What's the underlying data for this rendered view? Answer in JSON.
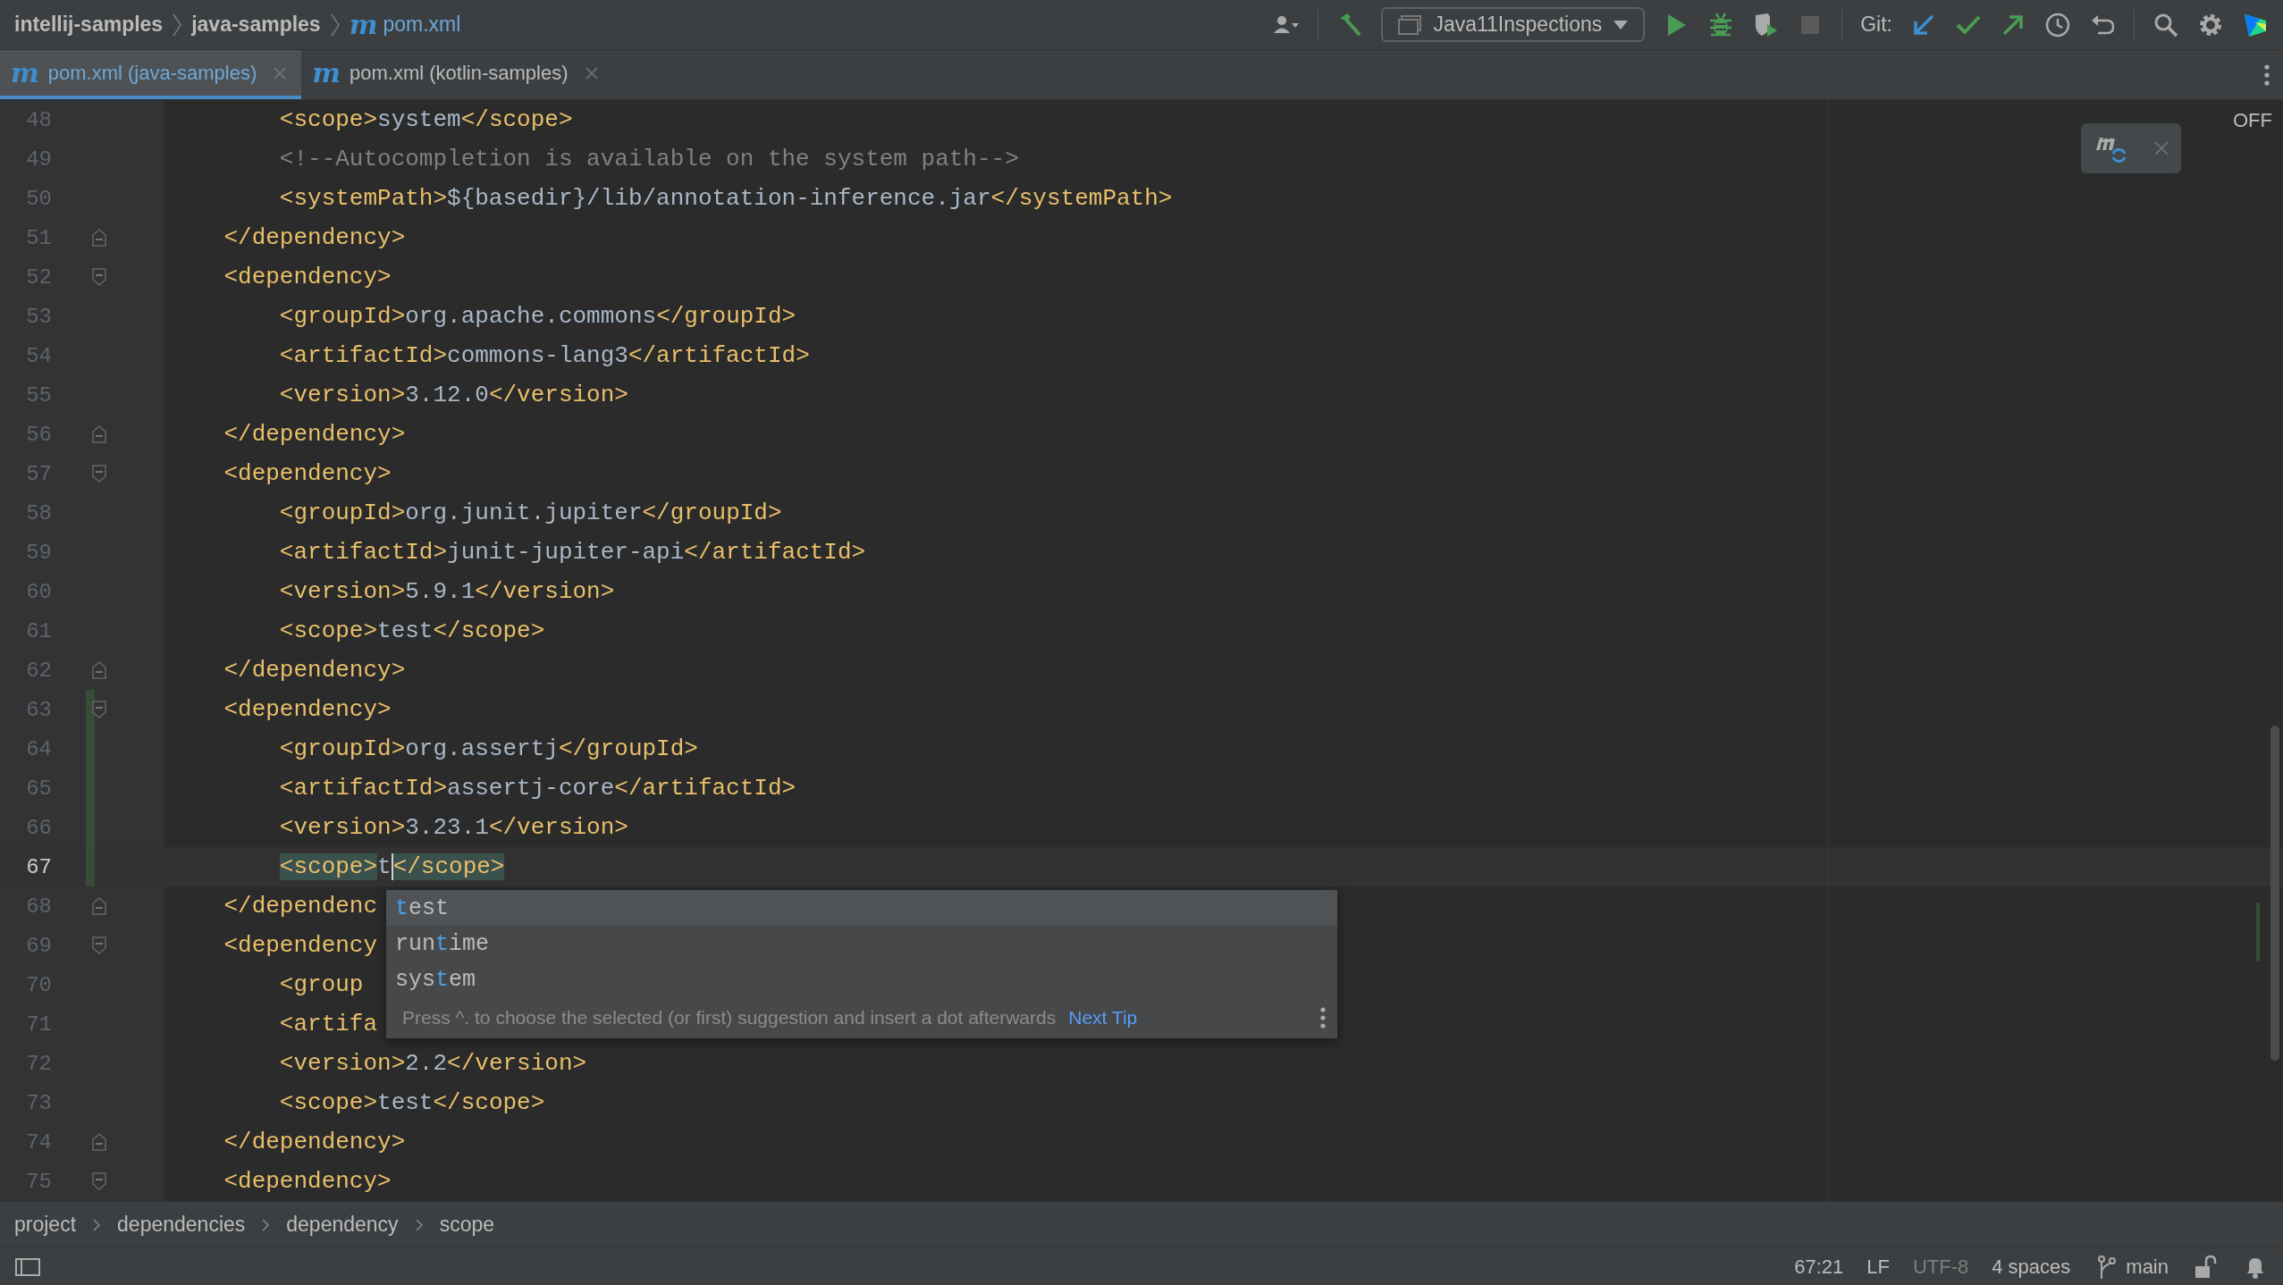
{
  "navbar": {
    "path": [
      {
        "label": "intellij-samples",
        "kind": "folder"
      },
      {
        "label": "java-samples",
        "kind": "folder"
      },
      {
        "label": "pom.xml",
        "kind": "file",
        "glyph": "m"
      }
    ],
    "run_config": "Java11Inspections",
    "git_label": "Git:"
  },
  "tabs": [
    {
      "glyph": "m",
      "label": "pom.xml (java-samples)",
      "selected": true
    },
    {
      "glyph": "m",
      "label": "pom.xml (kotlin-samples)",
      "selected": false
    }
  ],
  "editor": {
    "highlighting": "OFF",
    "lines": [
      {
        "number": "48",
        "kind": "plain",
        "tokens": [
          {
            "kind": "tag",
            "text": "        <scope>"
          },
          {
            "kind": "value",
            "text": "system"
          },
          {
            "kind": "tag",
            "text": "</scope>"
          }
        ]
      },
      {
        "number": "49",
        "kind": "plain",
        "tokens": [
          {
            "kind": "comment",
            "text": "        <!--Autocompletion is available on the system path-->"
          }
        ]
      },
      {
        "number": "50",
        "kind": "plain",
        "tokens": [
          {
            "kind": "tag",
            "text": "        <systemPath>"
          },
          {
            "kind": "value",
            "text": "${basedir}/lib/annotation-inference.jar"
          },
          {
            "kind": "tag",
            "text": "</systemPath>"
          }
        ]
      },
      {
        "number": "51",
        "kind": "fold_end",
        "tokens": [
          {
            "kind": "tag",
            "text": "    </dependency>"
          }
        ]
      },
      {
        "number": "52",
        "kind": "fold_start",
        "tokens": [
          {
            "kind": "tag",
            "text": "    <dependency>"
          }
        ]
      },
      {
        "number": "53",
        "kind": "plain",
        "tokens": [
          {
            "kind": "tag",
            "text": "        <groupId>"
          },
          {
            "kind": "value",
            "text": "org.apache.commons"
          },
          {
            "kind": "tag",
            "text": "</groupId>"
          }
        ]
      },
      {
        "number": "54",
        "kind": "plain",
        "tokens": [
          {
            "kind": "tag",
            "text": "        <artifactId>"
          },
          {
            "kind": "value",
            "text": "commons-lang3"
          },
          {
            "kind": "tag",
            "text": "</artifactId>"
          }
        ]
      },
      {
        "number": "55",
        "kind": "plain",
        "tokens": [
          {
            "kind": "tag",
            "text": "        <version>"
          },
          {
            "kind": "value",
            "text": "3.12.0"
          },
          {
            "kind": "tag",
            "text": "</version>"
          }
        ]
      },
      {
        "number": "56",
        "kind": "fold_end",
        "tokens": [
          {
            "kind": "tag",
            "text": "    </dependency>"
          }
        ]
      },
      {
        "number": "57",
        "kind": "fold_start",
        "tokens": [
          {
            "kind": "tag",
            "text": "    <dependency>"
          }
        ]
      },
      {
        "number": "58",
        "kind": "plain",
        "tokens": [
          {
            "kind": "tag",
            "text": "        <groupId>"
          },
          {
            "kind": "value",
            "text": "org.junit.jupiter"
          },
          {
            "kind": "tag",
            "text": "</groupId>"
          }
        ]
      },
      {
        "number": "59",
        "kind": "plain",
        "tokens": [
          {
            "kind": "tag",
            "text": "        <artifactId>"
          },
          {
            "kind": "value",
            "text": "junit-jupiter-api"
          },
          {
            "kind": "tag",
            "text": "</artifactId>"
          }
        ]
      },
      {
        "number": "60",
        "kind": "plain",
        "tokens": [
          {
            "kind": "tag",
            "text": "        <version>"
          },
          {
            "kind": "value",
            "text": "5.9.1"
          },
          {
            "kind": "tag",
            "text": "</version>"
          }
        ]
      },
      {
        "number": "61",
        "kind": "plain",
        "tokens": [
          {
            "kind": "tag",
            "text": "        <scope>"
          },
          {
            "kind": "value",
            "text": "test"
          },
          {
            "kind": "tag",
            "text": "</scope>"
          }
        ]
      },
      {
        "number": "62",
        "kind": "fold_end",
        "tokens": [
          {
            "kind": "tag",
            "text": "    </dependency>"
          }
        ]
      },
      {
        "number": "63",
        "kind": "fold_start",
        "changed": true,
        "tokens": [
          {
            "kind": "tag",
            "text": "    <dependency>"
          }
        ]
      },
      {
        "number": "64",
        "kind": "plain",
        "changed": true,
        "tokens": [
          {
            "kind": "tag",
            "text": "        <groupId>"
          },
          {
            "kind": "value",
            "text": "org.assertj"
          },
          {
            "kind": "tag",
            "text": "</groupId>"
          }
        ]
      },
      {
        "number": "65",
        "kind": "plain",
        "changed": true,
        "tokens": [
          {
            "kind": "tag",
            "text": "        <artifactId>"
          },
          {
            "kind": "value",
            "text": "assertj-core"
          },
          {
            "kind": "tag",
            "text": "</artifactId>"
          }
        ]
      },
      {
        "number": "66",
        "kind": "plain",
        "changed": true,
        "tokens": [
          {
            "kind": "tag",
            "text": "        <version>"
          },
          {
            "kind": "value",
            "text": "3.23.1"
          },
          {
            "kind": "tag",
            "text": "</version>"
          }
        ]
      },
      {
        "number": "67",
        "kind": "plain",
        "changed": true,
        "current": true,
        "tokens": [
          {
            "kind": "tag_match",
            "text": "        <scope>"
          },
          {
            "kind": "value",
            "text": "t",
            "caret": true
          },
          {
            "kind": "tag_match",
            "text": "</scope>"
          }
        ]
      },
      {
        "number": "68",
        "kind": "fold_end",
        "tokens": [
          {
            "kind": "tag",
            "text": "    </dependenc"
          }
        ]
      },
      {
        "number": "69",
        "kind": "fold_start",
        "tokens": [
          {
            "kind": "tag",
            "text": "    <dependency"
          }
        ]
      },
      {
        "number": "70",
        "kind": "plain",
        "tokens": [
          {
            "kind": "tag",
            "text": "        <group"
          }
        ]
      },
      {
        "number": "71",
        "kind": "plain",
        "tokens": [
          {
            "kind": "tag",
            "text": "        <artifa"
          }
        ]
      },
      {
        "number": "72",
        "kind": "plain",
        "tokens": [
          {
            "kind": "tag",
            "text": "        <version>"
          },
          {
            "kind": "value",
            "text": "2.2"
          },
          {
            "kind": "tag",
            "text": "</version>"
          }
        ]
      },
      {
        "number": "73",
        "kind": "plain",
        "tokens": [
          {
            "kind": "tag",
            "text": "        <scope>"
          },
          {
            "kind": "value",
            "text": "test"
          },
          {
            "kind": "tag",
            "text": "</scope>"
          }
        ]
      },
      {
        "number": "74",
        "kind": "fold_end",
        "tokens": [
          {
            "kind": "tag",
            "text": "    </dependency>"
          }
        ]
      },
      {
        "number": "75",
        "kind": "fold_start",
        "tokens": [
          {
            "kind": "tag",
            "text": "    <dependency>"
          }
        ]
      }
    ],
    "completion": {
      "items": [
        {
          "match": "t",
          "post": "est",
          "selected": true
        },
        {
          "pre": "run",
          "match": "t",
          "post": "ime",
          "selected": false
        },
        {
          "pre": "sys",
          "match": "t",
          "post": "em",
          "selected": false
        }
      ],
      "hint": "Press ^. to choose the selected (or first) suggestion and insert a dot afterwards",
      "link": "Next Tip"
    }
  },
  "breadcrumbs": [
    "project",
    "dependencies",
    "dependency",
    "scope"
  ],
  "status_bar": {
    "position": "67:21",
    "line_separator": "LF",
    "encoding": "UTF-8",
    "indent": "4 spaces",
    "branch": "main"
  }
}
